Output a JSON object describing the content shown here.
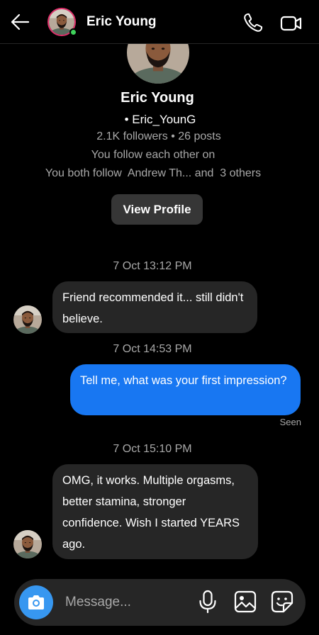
{
  "header": {
    "name": "Eric Young"
  },
  "profile": {
    "name": "Eric Young",
    "username": "• Eric_YounG",
    "stats": "2.1K followers • 26 posts",
    "follow_status": "You follow each other on",
    "mutual": "You both follow  Andrew Th... and  3 others",
    "view_profile_label": "View Profile"
  },
  "messages": [
    {
      "timestamp": "7 Oct 13:12 PM",
      "direction": "incoming",
      "text": "Friend recommended it... still didn't believe."
    },
    {
      "timestamp": "7 Oct 14:53 PM",
      "direction": "outgoing",
      "text": "Tell me, what was your first impression?",
      "status": "Seen"
    },
    {
      "timestamp": "7 Oct 15:10 PM",
      "direction": "incoming",
      "text": "OMG, it works. Multiple orgasms, better stamina, stronger confidence. Wish I started YEARS ago."
    }
  ],
  "composer": {
    "placeholder": "Message..."
  },
  "icons": {
    "back": "arrow-left-icon",
    "call": "phone-icon",
    "video": "video-camera-icon",
    "camera": "camera-icon",
    "mic": "microphone-icon",
    "gallery": "image-icon",
    "sticker": "sticker-icon"
  },
  "colors": {
    "outgoing_bubble": "#1877f2",
    "incoming_bubble": "#262626",
    "camera_button": "#3797f0",
    "online": "#3fd35b"
  }
}
